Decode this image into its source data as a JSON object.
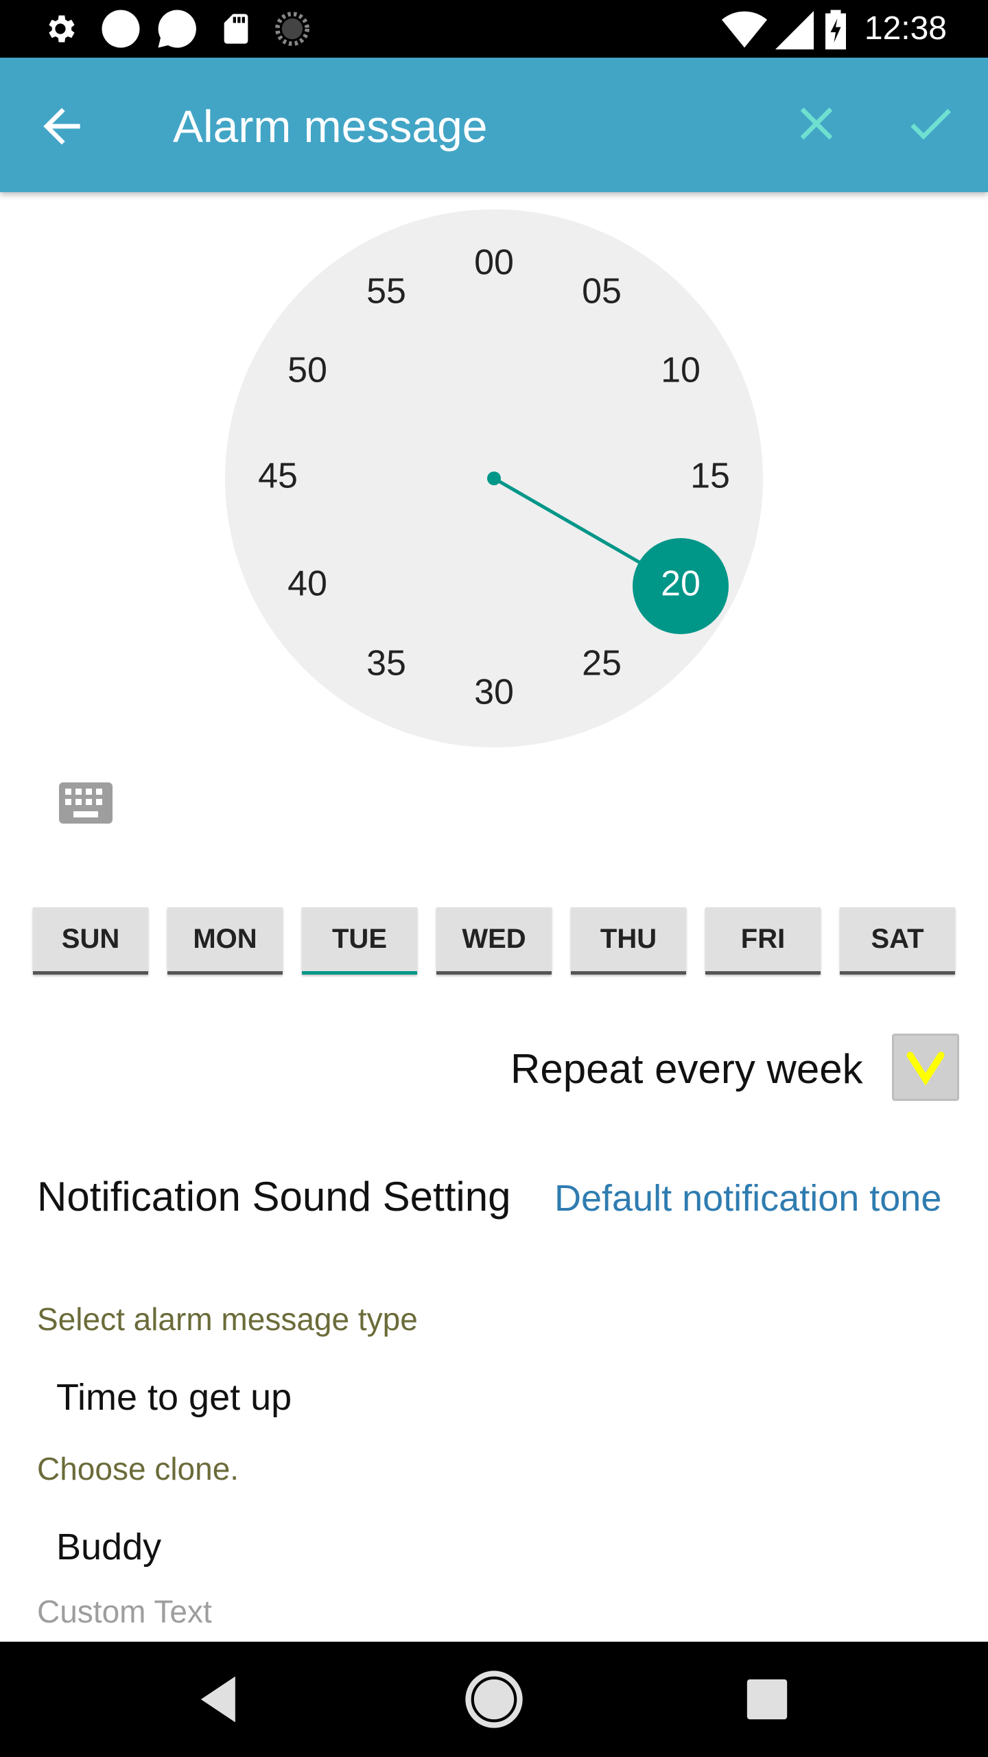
{
  "status_bar": {
    "time": "12:38",
    "icons_left": [
      "settings-icon",
      "circle-icon",
      "chat-bubble-icon",
      "sd-card-icon",
      "loading-icon"
    ],
    "icons_right": [
      "wifi-icon",
      "signal-icon",
      "battery-charging-icon"
    ]
  },
  "app_bar": {
    "title": "Alarm message",
    "back_icon": "arrow-back-icon",
    "close_icon": "close-icon",
    "confirm_icon": "check-icon",
    "background_color": "#42a5c6",
    "accent_color": "#6fe0d0"
  },
  "clock": {
    "mode": "minutes",
    "selected": "20",
    "labels": [
      "00",
      "05",
      "10",
      "15",
      "20",
      "25",
      "30",
      "35",
      "40",
      "45",
      "50",
      "55"
    ],
    "accent_color": "#009688",
    "face_color": "#efefef"
  },
  "keyboard_toggle": {
    "icon": "keyboard-icon"
  },
  "days": [
    {
      "label": "SUN",
      "selected": false
    },
    {
      "label": "MON",
      "selected": false
    },
    {
      "label": "TUE",
      "selected": true
    },
    {
      "label": "WED",
      "selected": false
    },
    {
      "label": "THU",
      "selected": false
    },
    {
      "label": "FRI",
      "selected": false
    },
    {
      "label": "SAT",
      "selected": false
    }
  ],
  "repeat": {
    "label": "Repeat every week",
    "checked": true,
    "check_color": "#ffff00"
  },
  "sound": {
    "label": "Notification Sound Setting",
    "value": "Default notification tone"
  },
  "message_type": {
    "label": "Select alarm message type",
    "value": "Time to get up"
  },
  "clone": {
    "label": "Choose clone.",
    "value": "Buddy"
  },
  "custom_text": {
    "placeholder": "Custom Text"
  },
  "nav_bar": {
    "back_icon": "nav-back-icon",
    "home_icon": "nav-home-icon",
    "recents_icon": "nav-recents-icon"
  }
}
